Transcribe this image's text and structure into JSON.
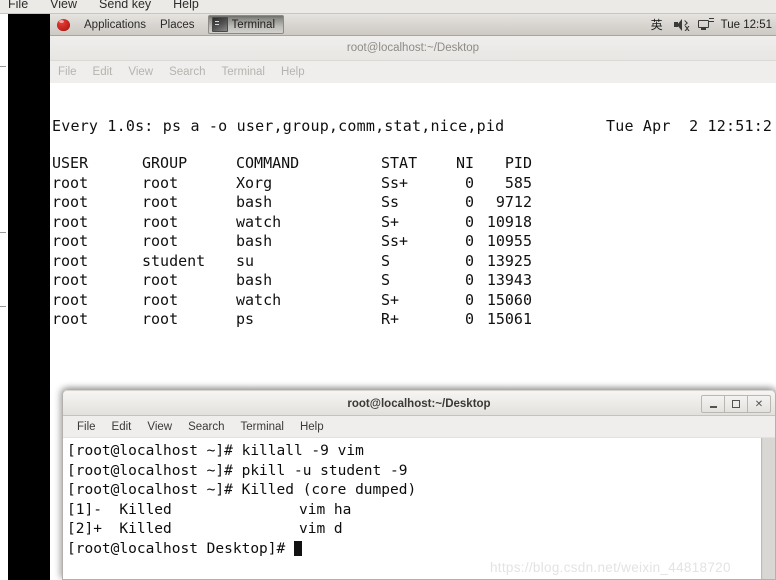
{
  "viewer_menubar": {
    "items": [
      "File",
      "View",
      "Send key",
      "Help"
    ]
  },
  "gnome_panel": {
    "applications_label": "Applications",
    "places_label": "Places",
    "task_label": "Terminal",
    "ime_indicator": "英",
    "clock": "Tue 12:51"
  },
  "background_terminal": {
    "title": "root@localhost:~/Desktop",
    "menu": [
      "File",
      "Edit",
      "View",
      "Search",
      "Terminal",
      "Help"
    ],
    "watch_command": "Every 1.0s: ps a -o user,group,comm,stat,nice,pid",
    "watch_date": "Tue Apr  2 12:51:2",
    "columns": [
      "USER",
      "GROUP",
      "COMMAND",
      "STAT",
      "NI",
      "PID"
    ],
    "rows": [
      {
        "user": "root",
        "group": "root",
        "command": "Xorg",
        "stat": "Ss+",
        "ni": "0",
        "pid": "585"
      },
      {
        "user": "root",
        "group": "root",
        "command": "bash",
        "stat": "Ss",
        "ni": "0",
        "pid": "9712"
      },
      {
        "user": "root",
        "group": "root",
        "command": "watch",
        "stat": "S+",
        "ni": "0",
        "pid": "10918"
      },
      {
        "user": "root",
        "group": "root",
        "command": "bash",
        "stat": "Ss+",
        "ni": "0",
        "pid": "10955"
      },
      {
        "user": "root",
        "group": "student",
        "command": "su",
        "stat": "S",
        "ni": "0",
        "pid": "13925"
      },
      {
        "user": "root",
        "group": "root",
        "command": "bash",
        "stat": "S",
        "ni": "0",
        "pid": "13943"
      },
      {
        "user": "root",
        "group": "root",
        "command": "watch",
        "stat": "S+",
        "ni": "0",
        "pid": "15060"
      },
      {
        "user": "root",
        "group": "root",
        "command": "ps",
        "stat": "R+",
        "ni": "0",
        "pid": "15061"
      }
    ]
  },
  "foreground_terminal": {
    "title": "root@localhost:~/Desktop",
    "menu": [
      "File",
      "Edit",
      "View",
      "Search",
      "Terminal",
      "Help"
    ],
    "minimize_label": "_",
    "maximize_label": "□",
    "close_label": "✕",
    "lines": [
      "[root@localhost ~]# killall -9 vim",
      "[root@localhost ~]# pkill -u student -9",
      "[root@localhost ~]# Killed (core dumped)"
    ],
    "jobs": [
      {
        "tag": "[1]-  Killed",
        "cmd": "vim ha"
      },
      {
        "tag": "[2]+  Killed",
        "cmd": "vim d"
      }
    ],
    "prompt": "[root@localhost Desktop]# "
  },
  "watermark": "https://blog.csdn.net/weixin_44818720"
}
